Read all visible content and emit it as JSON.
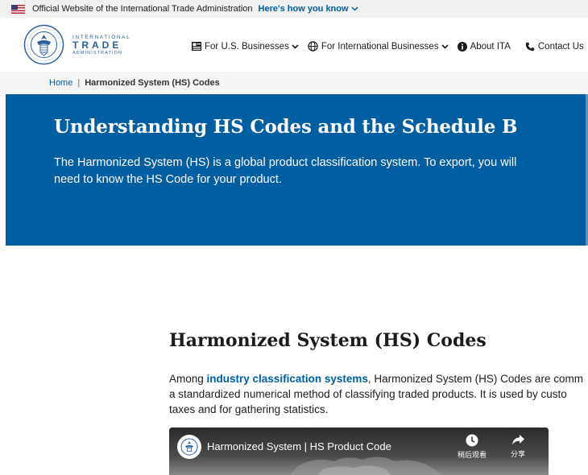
{
  "gov_banner": {
    "text": "Official Website of the International Trade Administration",
    "link": "Here's how you know"
  },
  "logo": {
    "line1": "INTERNATIONAL",
    "line2": "TRADE",
    "line3": "ADMINISTRATION"
  },
  "nav": [
    {
      "label": "For U.S. Businesses",
      "icon": "flag-icon"
    },
    {
      "label": "For International Businesses",
      "icon": "globe-icon"
    },
    {
      "label": "About ITA",
      "icon": "info-icon"
    },
    {
      "label": "Contact Us",
      "icon": "phone-icon"
    }
  ],
  "breadcrumb": {
    "home": "Home",
    "separator": "|",
    "current": "Harmonized System (HS) Codes"
  },
  "hero": {
    "title": "Understanding HS Codes and the Schedule B",
    "description": "The Harmonized System (HS) is a global product classification system. To export, you will need to know the HS Code for your product."
  },
  "content": {
    "title": "Harmonized System (HS) Codes",
    "para_prefix": "Among ",
    "para_link": "industry classification systems",
    "para_line1_rest": ", Harmonized System (HS) Codes are comm",
    "para_line2": "a standardized numerical method of classifying traded products. It is used by custo",
    "para_line3": "taxes and for gathering statistics."
  },
  "video": {
    "title": "Harmonized System | HS Product Code",
    "watch_later": "稍后观看",
    "share": "分享"
  },
  "colors": {
    "primary_blue": "#005ea2",
    "banner_bg": "#f0f0f0",
    "breadcrumb_bg": "#f5f5f5",
    "logo_blue": "#2c5f9e"
  }
}
